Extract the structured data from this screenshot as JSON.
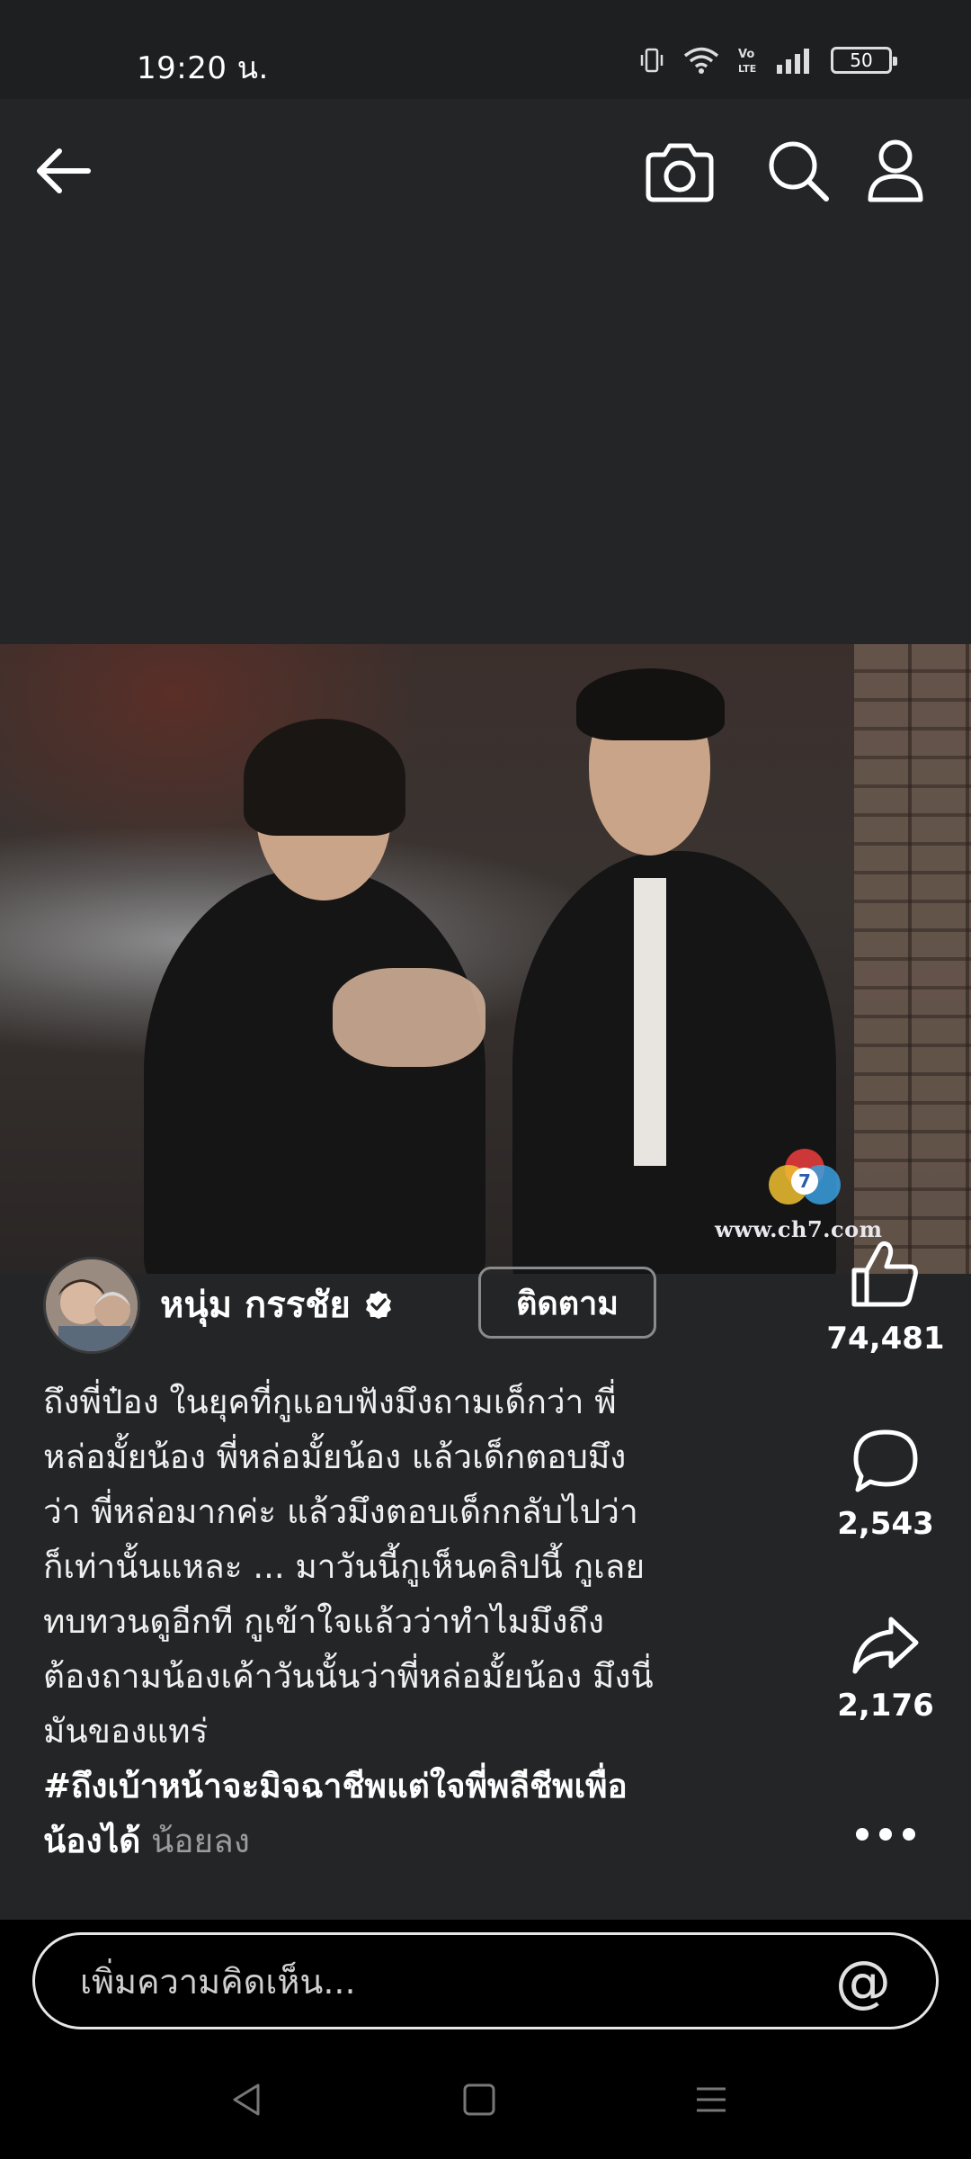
{
  "status_bar": {
    "time": "19:20 น.",
    "battery": "50",
    "icons": [
      "vibrate-icon",
      "wifi-icon",
      "volte-icon",
      "signal-icon",
      "battery-icon"
    ]
  },
  "top_nav": {
    "icons": [
      "back-arrow-icon",
      "camera-icon",
      "search-icon",
      "profile-icon"
    ]
  },
  "video": {
    "watermark": "www.ch7.com"
  },
  "post": {
    "author": "หนุ่ม กรรชัย",
    "verified": true,
    "follow_label": "ติดตาม",
    "caption_lines": [
      "ถึงพี่ป๋อง ในยุคที่กูแอบฟังมึงถามเด็กว่า พี่",
      "หล่อมั้ยน้อง พี่หล่อมั้ยน้อง แล้วเด็กตอบมึง",
      "ว่า พี่หล่อมากค่ะ แล้วมึงตอบเด็กกลับไปว่า",
      "ก็เท่านั้นแหละ ... มาวันนี้กูเห็นคลิปนี้ กูเลย",
      "ทบทวนดูอีกที กูเข้าใจแล้วว่าทำไมมึงถึง",
      "ต้องถามน้องเค้าวันนั้นว่าพี่หล่อมั้ยน้อง มึงนี่",
      "มันของแทร่"
    ],
    "hashtag_line1": "#ถึงเบ้าหน้าจะมิจฉาชีพแต่ใจพี่พลีชีพเพื่อ",
    "hashtag_line2": "น้องได้",
    "see_less": "น้อยลง"
  },
  "actions": {
    "likes": "74,481",
    "comments": "2,543",
    "shares": "2,176"
  },
  "comment_bar": {
    "placeholder": "เพิ่มความคิดเห็น...",
    "mention_symbol": "@"
  },
  "colors": {
    "background": "#242526",
    "status_bar": "#1e1f20",
    "text": "#ffffff",
    "muted": "#9a9b9c"
  }
}
